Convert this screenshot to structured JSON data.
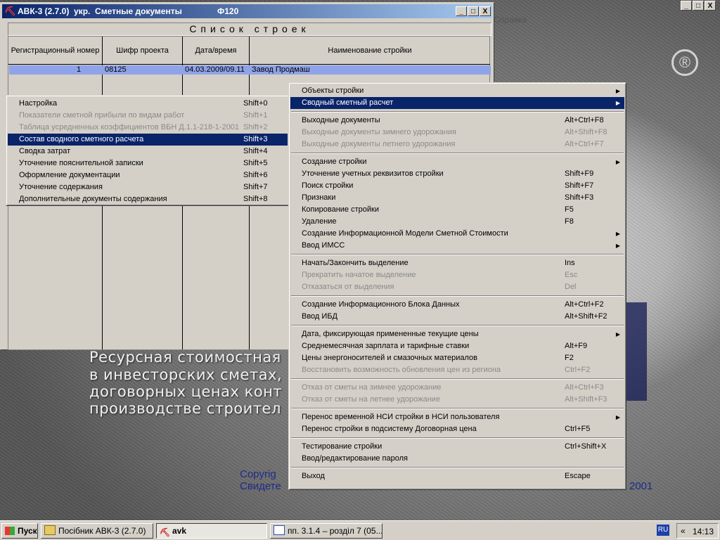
{
  "window": {
    "title": "АВК-3 (2.7.0)  укр.  Сметные документы",
    "code": "Ф120",
    "buttons": [
      "_",
      "□",
      "X"
    ]
  },
  "background": {
    "lines": [
      "Ресурсная стоимостная",
      "в инвесторских сметах,",
      "договорных ценах конт",
      "производстве строител"
    ],
    "copyright_1": "Copyrig",
    "copyright_2": "Свидете",
    "year": "2001",
    "help_menu": "Справка",
    "mdi_buttons": [
      "_",
      "□",
      "X"
    ],
    "reg_mark": "®"
  },
  "list": {
    "title": "Список строек",
    "columns": [
      "Регистрационный номер",
      "Шифр проекта",
      "Дата/время",
      "Наименование стройки"
    ],
    "rows": [
      {
        "number": "1",
        "code": "08125",
        "datetime": "04.03.2009/09.11",
        "name": "Завод Продмаш"
      }
    ]
  },
  "left_menu": {
    "items": [
      {
        "label": "Настройка",
        "shortcut": "Shift+0",
        "state": "normal"
      },
      {
        "label": "Показатели сметной прибыли по видам работ",
        "shortcut": "Shift+1",
        "state": "disabled"
      },
      {
        "label": "Таблица усредненных коэффициентов ВБН Д.1.1-218-1-2001",
        "shortcut": "Shift+2",
        "state": "disabled"
      },
      {
        "label": "Состав  сводного сметного расчета",
        "shortcut": "Shift+3",
        "state": "selected"
      },
      {
        "label": "Сводка затрат",
        "shortcut": "Shift+4",
        "state": "normal"
      },
      {
        "label": "Уточнение пояснительной записки",
        "shortcut": "Shift+5",
        "state": "normal"
      },
      {
        "label": "Оформление документации",
        "shortcut": "Shift+6",
        "state": "normal"
      },
      {
        "label": "Уточнение содержания",
        "shortcut": "Shift+7",
        "state": "normal"
      },
      {
        "label": "Дополнительные документы содержания",
        "shortcut": "Shift+8",
        "state": "normal"
      }
    ]
  },
  "right_menu": {
    "items": [
      {
        "label": "Объекты стройки",
        "shortcut": "",
        "arrow": true,
        "state": "normal"
      },
      {
        "label": "Сводный сметный расчет",
        "shortcut": "",
        "arrow": true,
        "state": "selected"
      },
      {
        "sep": true
      },
      {
        "label": "Выходные документы",
        "shortcut": "Alt+Ctrl+F8",
        "state": "normal"
      },
      {
        "label": "Выходные документы зимнего удорожания",
        "shortcut": "Alt+Shift+F8",
        "state": "disabled"
      },
      {
        "label": "Выходные документы летнего удорожания",
        "shortcut": "Alt+Ctrl+F7",
        "state": "disabled"
      },
      {
        "sep": true
      },
      {
        "label": "Создание стройки",
        "shortcut": "",
        "arrow": true,
        "state": "normal"
      },
      {
        "label": "Уточнение учетных реквизитов стройки",
        "shortcut": "Shift+F9",
        "state": "normal"
      },
      {
        "label": "Поиск стройки",
        "shortcut": "Shift+F7",
        "state": "normal"
      },
      {
        "label": "Признаки",
        "shortcut": "Shift+F3",
        "state": "normal"
      },
      {
        "label": "Копирование стройки",
        "shortcut": "F5",
        "state": "normal"
      },
      {
        "label": "Удаление",
        "shortcut": "F8",
        "state": "normal"
      },
      {
        "label": "Создание Информационной Модели Сметной Стоимости",
        "shortcut": "",
        "arrow": true,
        "state": "normal"
      },
      {
        "label": "Ввод ИМСС",
        "shortcut": "",
        "arrow": true,
        "state": "normal"
      },
      {
        "sep": true
      },
      {
        "label": "Начать/Закончить выделение",
        "shortcut": "Ins",
        "state": "normal"
      },
      {
        "label": "Прекратить начатое выделение",
        "shortcut": "Esc",
        "state": "disabled"
      },
      {
        "label": "Отказаться от выделения",
        "shortcut": "Del",
        "state": "disabled"
      },
      {
        "sep": true
      },
      {
        "label": "Создание Информационного Блока Данных",
        "shortcut": "Alt+Ctrl+F2",
        "state": "normal"
      },
      {
        "label": "Ввод ИБД",
        "shortcut": "Alt+Shift+F2",
        "state": "normal"
      },
      {
        "sep": true
      },
      {
        "label": "Дата, фиксирующая примененные текущие цены",
        "shortcut": "",
        "arrow": true,
        "state": "normal"
      },
      {
        "label": "Среднемесячная зарплата  и тарифные ставки",
        "shortcut": "Alt+F9",
        "state": "normal"
      },
      {
        "label": "Цены энергоносителей и смазочных материалов",
        "shortcut": "F2",
        "state": "normal"
      },
      {
        "label": "Восстановить возможность обновления цен  из региона",
        "shortcut": "Ctrl+F2",
        "state": "disabled"
      },
      {
        "sep": true
      },
      {
        "label": "Отказ от сметы на зимнее удорожание",
        "shortcut": "Alt+Ctrl+F3",
        "state": "disabled"
      },
      {
        "label": "Отказ от сметы на летнее удорожание",
        "shortcut": "Alt+Shift+F3",
        "state": "disabled"
      },
      {
        "sep": true
      },
      {
        "label": "Перенос временной НСИ стройки в НСИ пользователя",
        "shortcut": "",
        "arrow": true,
        "state": "normal"
      },
      {
        "label": "Перенос стройки в подсистему Договорная цена",
        "shortcut": "Ctrl+F5",
        "state": "normal"
      },
      {
        "sep": true
      },
      {
        "label": "Тестирование стройки",
        "shortcut": "Ctrl+Shift+X",
        "state": "normal"
      },
      {
        "label": "Ввод/редактирование пароля",
        "shortcut": "",
        "state": "normal"
      },
      {
        "sep": true
      },
      {
        "label": "Выход",
        "shortcut": "Escape",
        "state": "normal"
      }
    ]
  },
  "taskbar": {
    "start": "Пуск",
    "tasks": [
      "Посібник АВК-3 (2.7.0)",
      "avk",
      "пп. 3.1.4 – розділ 7 (05..."
    ],
    "lang": "RU",
    "arrows": "«",
    "time": "14:13"
  }
}
